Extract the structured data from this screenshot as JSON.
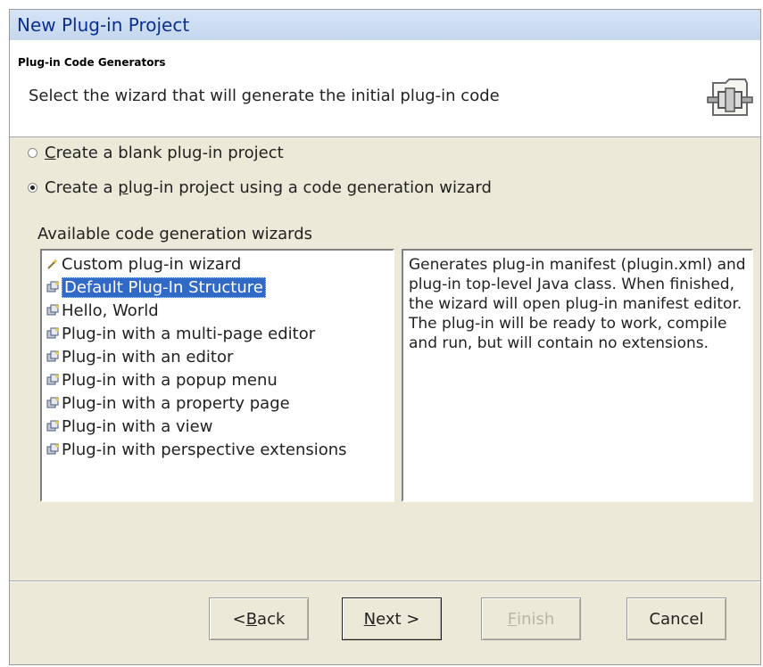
{
  "window": {
    "title": "New Plug-in Project"
  },
  "banner": {
    "heading": "Plug-in Code Generators",
    "description": "Select the wizard that will generate the initial plug-in code",
    "icon": "plugin-folder-icon"
  },
  "options": [
    {
      "pre": "",
      "mnemonic": "C",
      "post": "reate a blank plug-in project",
      "checked": false
    },
    {
      "pre": "Create a ",
      "mnemonic": "p",
      "post": "lug-in project using a code generation wizard",
      "checked": true
    }
  ],
  "wizards": {
    "label": "Available code generation wizards",
    "items": [
      {
        "label": "Custom plug-in wizard",
        "icon": "custom-wizard-icon",
        "selected": false
      },
      {
        "label": "Default Plug-In Structure",
        "icon": "wizard-icon",
        "selected": true
      },
      {
        "label": "Hello, World",
        "icon": "wizard-icon",
        "selected": false
      },
      {
        "label": "Plug-in with a multi-page editor",
        "icon": "wizard-icon",
        "selected": false
      },
      {
        "label": "Plug-in with an editor",
        "icon": "wizard-icon",
        "selected": false
      },
      {
        "label": "Plug-in with a popup menu",
        "icon": "wizard-icon",
        "selected": false
      },
      {
        "label": "Plug-in with a property page",
        "icon": "wizard-icon",
        "selected": false
      },
      {
        "label": "Plug-in with a view",
        "icon": "wizard-icon",
        "selected": false
      },
      {
        "label": "Plug-in with perspective extensions",
        "icon": "wizard-icon",
        "selected": false
      }
    ],
    "description": "Generates plug-in manifest (plugin.xml) and plug-in top-level Java class. When finished, the wizard will open plug-in manifest editor. The plug-in will be ready to work, compile and run, but will contain no extensions."
  },
  "buttons": {
    "back": {
      "pre": "< ",
      "mnemonic": "B",
      "post": "ack",
      "enabled": true
    },
    "next": {
      "pre": "",
      "mnemonic": "N",
      "post": "ext >",
      "enabled": true
    },
    "finish": {
      "pre": "",
      "mnemonic": "F",
      "post": "inish",
      "enabled": false
    },
    "cancel": {
      "label": "Cancel",
      "enabled": true
    }
  },
  "colors": {
    "selection": "#3169c6",
    "title_text": "#0b2f8f",
    "dialog_bg": "#ece9d8"
  }
}
